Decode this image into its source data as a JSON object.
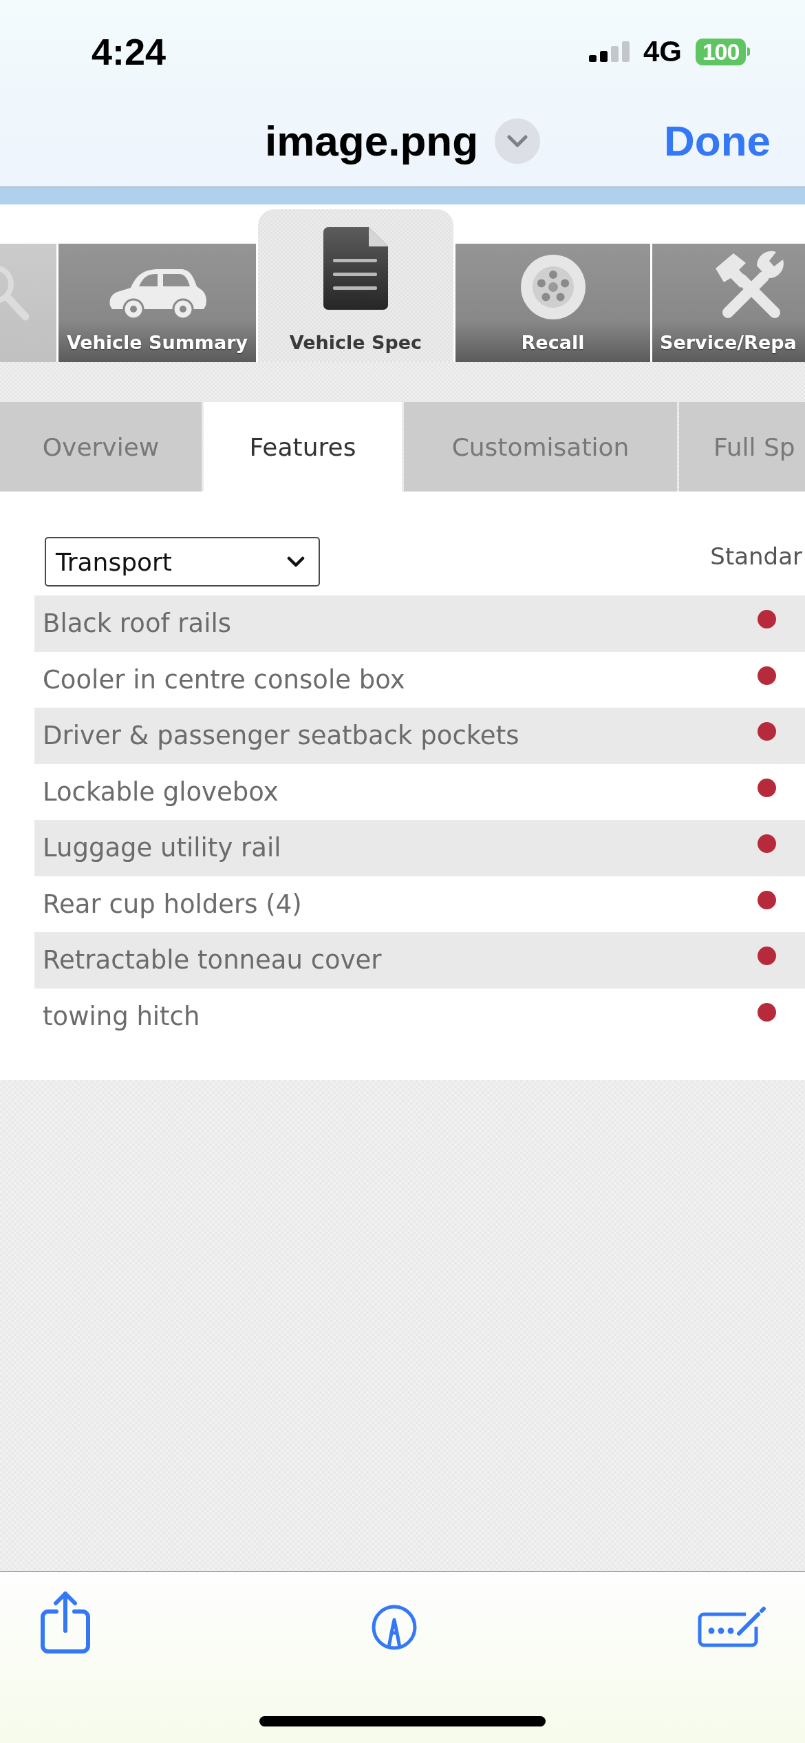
{
  "status_bar": {
    "time": "4:24",
    "network": "4G",
    "battery": "100"
  },
  "viewer_header": {
    "title": "image.png",
    "done_button": "Done"
  },
  "nav_tabs": [
    {
      "selected": false
    },
    {
      "label": "Vehicle Summary",
      "selected": false
    },
    {
      "label": "Vehicle Spec",
      "selected": true
    },
    {
      "label": "Recall",
      "selected": false
    },
    {
      "label": "Service/Repa",
      "selected": false
    }
  ],
  "sub_tabs": [
    {
      "label": "Overview",
      "selected": false
    },
    {
      "label": "Features",
      "selected": true
    },
    {
      "label": "Customisation",
      "selected": false
    },
    {
      "label": "Full Sp",
      "selected": false
    }
  ],
  "features": {
    "category_select": {
      "value": "Transport"
    },
    "column_header": "Standar",
    "rows": [
      {
        "name": "Black roof rails",
        "standard": true
      },
      {
        "name": "Cooler in centre console box",
        "standard": true
      },
      {
        "name": "Driver & passenger seatback pockets",
        "standard": true
      },
      {
        "name": "Lockable glovebox",
        "standard": true
      },
      {
        "name": "Luggage utility rail",
        "standard": true
      },
      {
        "name": "Rear cup holders (4)",
        "standard": true
      },
      {
        "name": "Retractable tonneau cover",
        "standard": true
      },
      {
        "name": "towing hitch",
        "standard": true
      }
    ]
  }
}
